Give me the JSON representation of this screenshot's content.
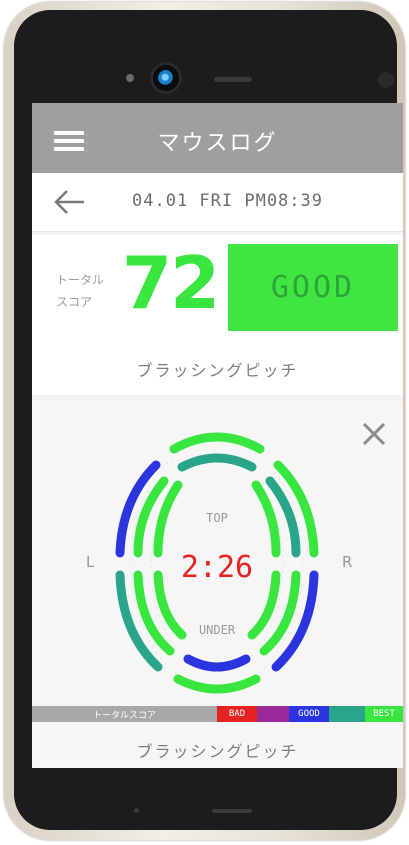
{
  "app": {
    "title": "マウスログ"
  },
  "date": {
    "label": "04.01 FRI PM08:39"
  },
  "score": {
    "label_line1": "トータル",
    "label_line2": "スコア",
    "value": "72",
    "grade": "GOOD",
    "caption": "ブラッシングピッチ"
  },
  "detail": {
    "top_label": "TOP",
    "under_label": "UNDER",
    "time": "2:26",
    "left_label": "L",
    "right_label": "R",
    "caption": "ブラッシングピッチ"
  },
  "legend": {
    "title": "トータルスコア",
    "bad": "BAD",
    "good": "GOOD",
    "best": "BEST"
  },
  "colors": {
    "green": "#39e53f",
    "blue": "#2a35e0",
    "teal": "#2aa58a",
    "red": "#e52323",
    "purple": "#9a2a9a"
  }
}
